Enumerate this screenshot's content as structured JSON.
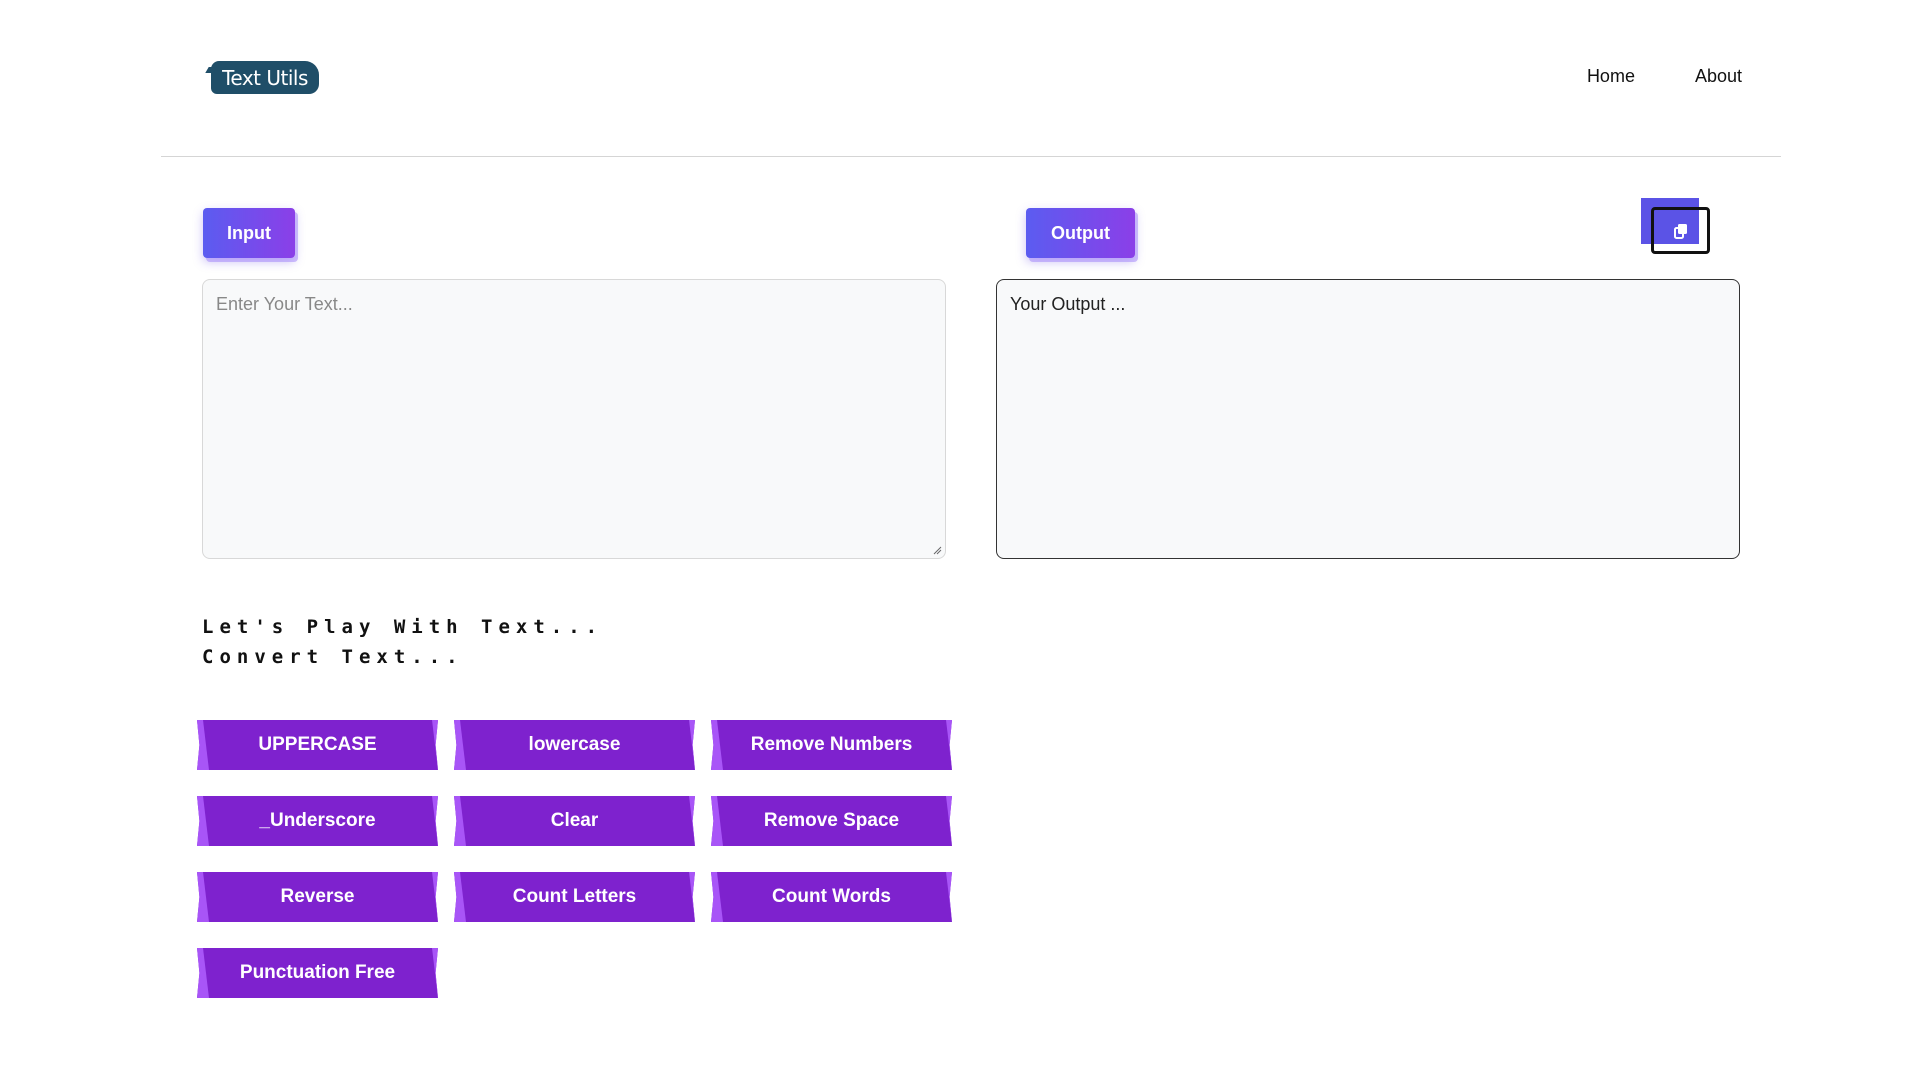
{
  "header": {
    "logo_text": "Text Utils",
    "nav": [
      {
        "label": "Home"
      },
      {
        "label": "About"
      }
    ]
  },
  "input": {
    "label": "Input",
    "placeholder": "Enter Your Text..."
  },
  "output": {
    "label": "Output",
    "text": "Your Output ..."
  },
  "copy_button": {
    "icon": "copy-icon"
  },
  "heading": {
    "line1": "Let's Play With Text...",
    "line2": "Convert Text..."
  },
  "actions": [
    {
      "label": "UPPERCASE"
    },
    {
      "label": "lowercase"
    },
    {
      "label": "Remove Numbers"
    },
    {
      "label": "_Underscore"
    },
    {
      "label": "Clear"
    },
    {
      "label": "Remove Space"
    },
    {
      "label": "Reverse"
    },
    {
      "label": "Count Letters"
    },
    {
      "label": "Count Words"
    },
    {
      "label": "Punctuation Free"
    }
  ],
  "colors": {
    "brand_logo": "#1f4e68",
    "button_purple": "#7e22ce",
    "label_gradient_start": "#5b5cf0",
    "label_gradient_end": "#8b3fe8"
  }
}
